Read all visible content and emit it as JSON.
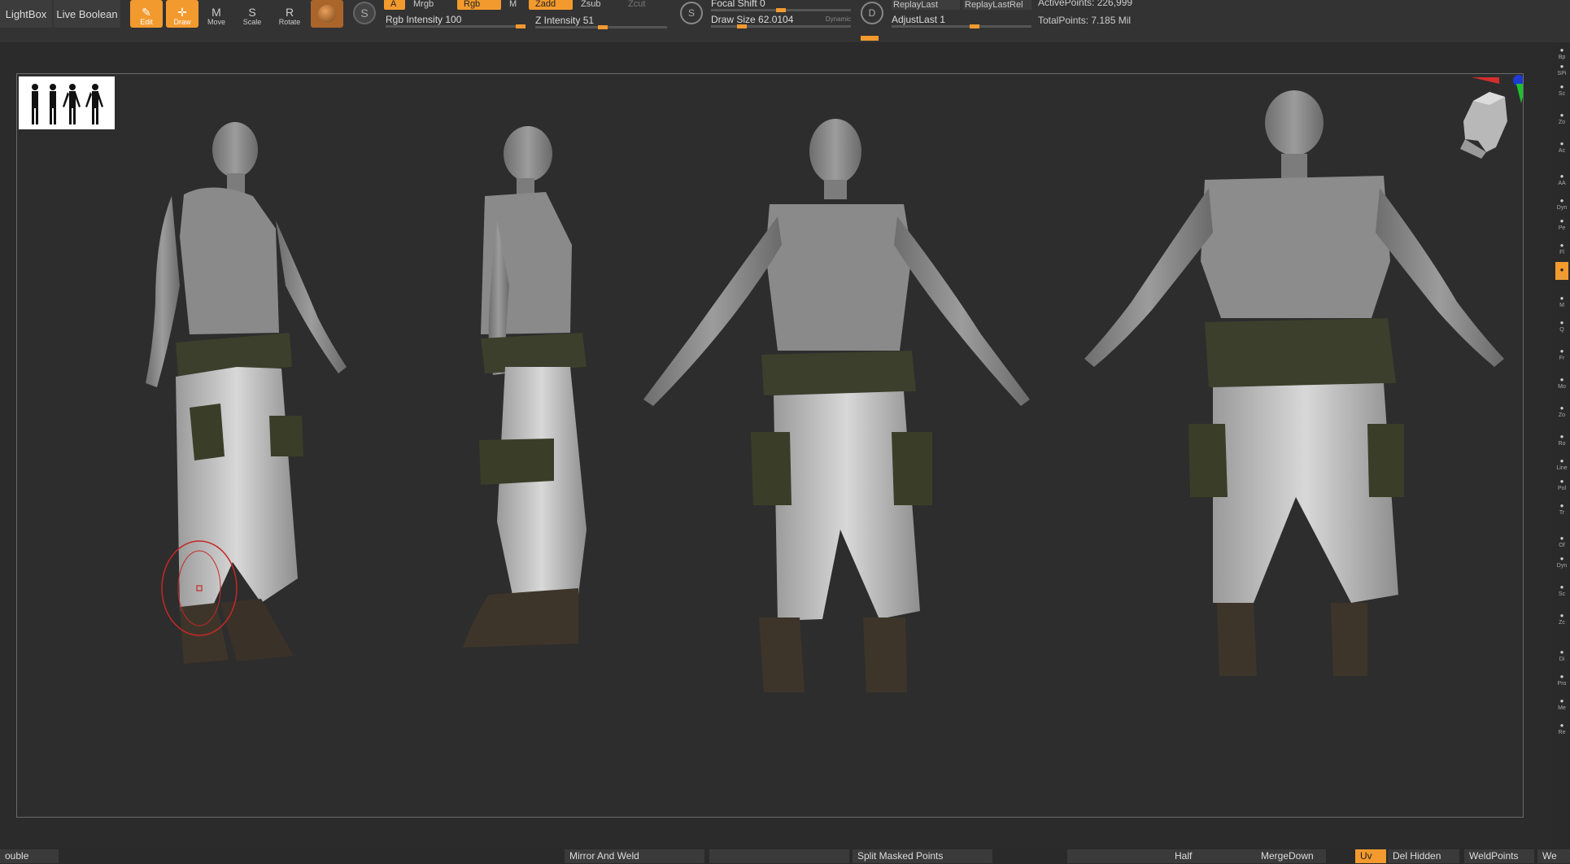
{
  "topbar": {
    "lightbox": "LightBox",
    "live_boolean": "Live Boolean",
    "tools": [
      {
        "label": "Edit",
        "icon": "✎"
      },
      {
        "label": "Draw",
        "icon": "✛"
      },
      {
        "label": "Move",
        "icon": "M"
      },
      {
        "label": "Scale",
        "icon": "S"
      },
      {
        "label": "Rotate",
        "icon": "R"
      }
    ],
    "a_label": "A",
    "mrgb": "Mrgb",
    "rgb": "Rgb",
    "m": "M",
    "zadd": "Zadd",
    "zsub": "Zsub",
    "zcut": "Zcut",
    "rgb_intensity": "Rgb Intensity 100",
    "z_intensity": "Z Intensity 51",
    "s_label": "S",
    "focal_shift": "Focal Shift 0",
    "draw_size": "Draw Size 62.0104",
    "dynamic": "Dynamic",
    "d_label": "D",
    "replay_last": "ReplayLast",
    "replay_last_rel": "ReplayLastRel",
    "adjust_last": "AdjustLast 1",
    "active_points": "ActivePoints: 226,999",
    "total_points": "TotalPoints: 7.185 Mil"
  },
  "sliders": {
    "rgb_intensity": 1.0,
    "z_intensity": 0.51,
    "focal_shift": 0.5,
    "draw_size": 0.2,
    "adjust_last": 0.6
  },
  "rail": {
    "items": [
      "Bp",
      "SPi",
      "Sc",
      "Zo",
      "Ac",
      "AA",
      "Dyn",
      "Pe",
      "Fl",
      "L",
      "M",
      "Q",
      "Fr",
      "Mo",
      "Zo",
      "Ro",
      "Line",
      "Pol",
      "Tr",
      "Of",
      "Dyn",
      "Sc",
      "Zc",
      "Di",
      "Pro",
      "Me",
      "Re"
    ]
  },
  "bottombar": {
    "items": [
      {
        "label": "ouble",
        "on": false
      },
      {
        "label": "Mirror And Weld",
        "on": false
      },
      {
        "label": "",
        "on": false
      },
      {
        "label": "Split Masked Points",
        "on": false
      },
      {
        "label": "",
        "on": false
      },
      {
        "label": "Half",
        "on": false
      },
      {
        "label": "MergeDown",
        "on": false
      },
      {
        "label": "Uv",
        "on": true
      },
      {
        "label": "Del Hidden",
        "on": false
      },
      {
        "label": "WeldPoints",
        "on": false
      },
      {
        "label": "We",
        "on": false
      }
    ]
  },
  "colors": {
    "accent": "#f29a2e",
    "cursor": "#c62828"
  },
  "viewport": {
    "views": [
      "three-quarter",
      "side",
      "front",
      "back"
    ]
  }
}
